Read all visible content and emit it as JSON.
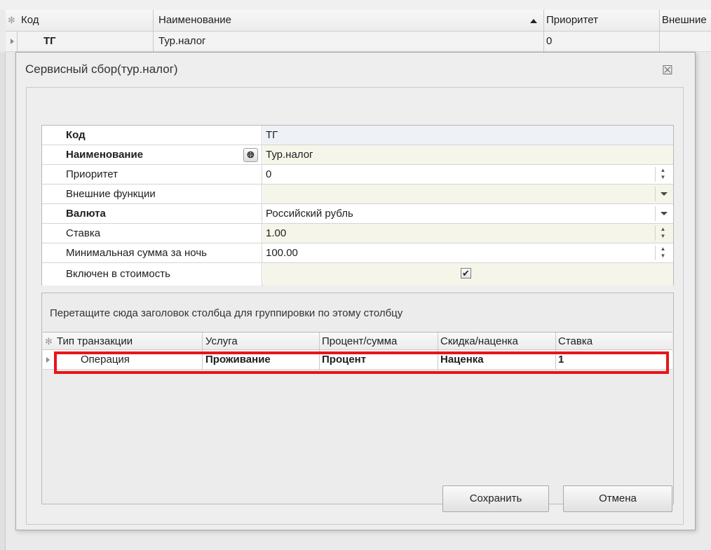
{
  "main_grid": {
    "columns": [
      "Код",
      "Наименование",
      "Приоритет",
      "Внешние"
    ],
    "row": {
      "code": "ТГ",
      "name": "Тур.налог",
      "priority": "0"
    }
  },
  "dialog": {
    "title": "Сервисный сбор(тур.налог)",
    "close_glyph": "☒",
    "properties": [
      {
        "label": "Код",
        "value": "ТГ"
      },
      {
        "label": "Наименование",
        "value": "Тур.налог"
      },
      {
        "label": "Приоритет",
        "value": "0"
      },
      {
        "label": "Внешние функции",
        "value": ""
      },
      {
        "label": "Валюта",
        "value": "Российский рубль"
      },
      {
        "label": "Ставка",
        "value": "1.00"
      },
      {
        "label": "Минимальная сумма за ночь",
        "value": "100.00"
      },
      {
        "label": "Включен в стоимость",
        "value": "✔"
      }
    ],
    "group_panel_text": "Перетащите сюда заголовок столбца для группировки по этому столбцу",
    "transactions": {
      "columns": [
        "Тип транзакции",
        "Услуга",
        "Процент/сумма",
        "Скидка/наценка",
        "Ставка"
      ],
      "rows": [
        [
          "Операция",
          "Проживание",
          "Процент",
          "Наценка",
          "1"
        ]
      ]
    },
    "buttons": {
      "save": "Сохранить",
      "cancel": "Отмена"
    }
  },
  "colors": {
    "highlight": "#e8141c",
    "field_bg": "#f5f5ea"
  },
  "icons": {
    "globe": "globe-icon",
    "checkbox": "check-icon",
    "close": "close-icon"
  }
}
